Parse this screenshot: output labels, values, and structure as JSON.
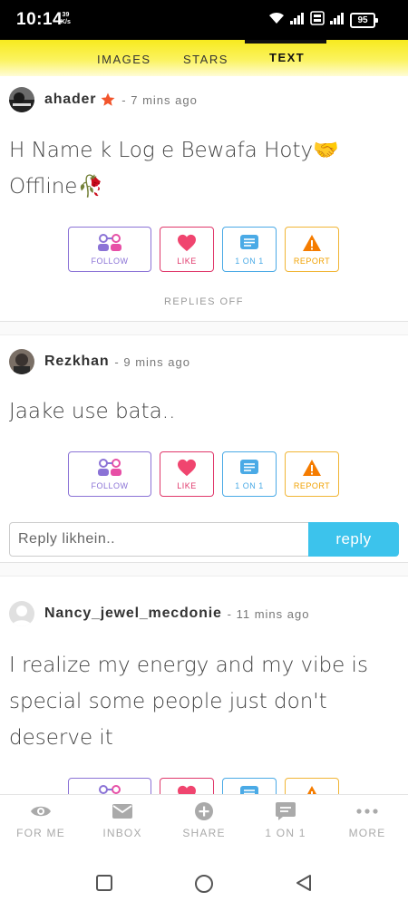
{
  "status_bar": {
    "time": "10:14",
    "net_speed_value": "39",
    "net_speed_unit": "K/s",
    "battery": "95"
  },
  "tabs": [
    {
      "label": "IMAGES",
      "active": false
    },
    {
      "label": "STARS",
      "active": false
    },
    {
      "label": "TEXT",
      "active": true
    }
  ],
  "posts": [
    {
      "username": "ahader",
      "time": "- 7 mins ago",
      "text_line1": "H Name k Log e Bewafa Hoty🤝",
      "text_line2": "Offline🥀",
      "footer": "REPLIES OFF"
    },
    {
      "username": "Rezkhan",
      "time": "- 9 mins ago",
      "text_line1": "Jaake use bata.."
    },
    {
      "username": "Nancy_jewel_mecdonie",
      "time": "- 11 mins ago",
      "text_line1": "I realize my energy and my vibe is",
      "text_line2": "special some people just don't",
      "text_line3": "deserve it"
    }
  ],
  "actions": {
    "follow": "FOLLOW",
    "like": "LIKE",
    "one_on_one": "1 ON 1",
    "report": "REPORT"
  },
  "reply": {
    "placeholder": "Reply likhein..",
    "button": "reply"
  },
  "bottom_nav": [
    {
      "label": "FOR ME",
      "icon": "eye-icon"
    },
    {
      "label": "INBOX",
      "icon": "mail-icon"
    },
    {
      "label": "SHARE",
      "icon": "plus-circle-icon"
    },
    {
      "label": "1 ON 1",
      "icon": "chat-icon"
    },
    {
      "label": "MORE",
      "icon": "more-dots-icon"
    }
  ],
  "colors": {
    "tab_bar": "#f7ea1f",
    "follow": "#8b73d6",
    "like": "#e0386b",
    "one_on_one": "#4aaae6",
    "report": "#f1b535",
    "reply_button": "#3cc3ec"
  }
}
